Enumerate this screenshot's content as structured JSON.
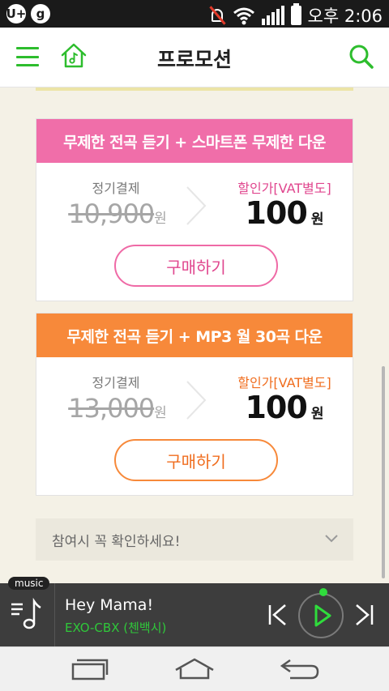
{
  "status_bar": {
    "left_icons": [
      "U+",
      "g"
    ],
    "time": "오후 2:06",
    "icons": [
      "mute-icon",
      "wifi-icon",
      "signal-icon",
      "battery-icon"
    ]
  },
  "header": {
    "title": "프로모션",
    "icons": [
      "menu-icon",
      "home-music-icon",
      "search-icon"
    ],
    "accent_color": "#2dbd2d"
  },
  "promotions": [
    {
      "title": "무제한 전곡 듣기 + 스마트폰 무제한 다운",
      "regular_label": "정기결제",
      "regular_price": "10,900",
      "regular_unit": "원",
      "discount_label": "할인가[VAT별도]",
      "discount_price": "100",
      "discount_unit": "원",
      "button_label": "구매하기",
      "color": "#f06ea9"
    },
    {
      "title": "무제한 전곡 듣기 + MP3 월 30곡 다운",
      "regular_label": "정기결제",
      "regular_price": "13,000",
      "regular_unit": "원",
      "discount_label": "할인가[VAT별도]",
      "discount_price": "100",
      "discount_unit": "원",
      "button_label": "구매하기",
      "color": "#f7893a"
    }
  ],
  "notice": {
    "text": "참여시 꼭 확인하세요!"
  },
  "player": {
    "tag": "music",
    "song_title": "Hey Mama!",
    "artist": "EXO-CBX (첸백시)",
    "artist_color": "#2fc83a"
  },
  "nav_bar": {
    "icons": [
      "recents-icon",
      "home-icon",
      "back-icon"
    ]
  }
}
